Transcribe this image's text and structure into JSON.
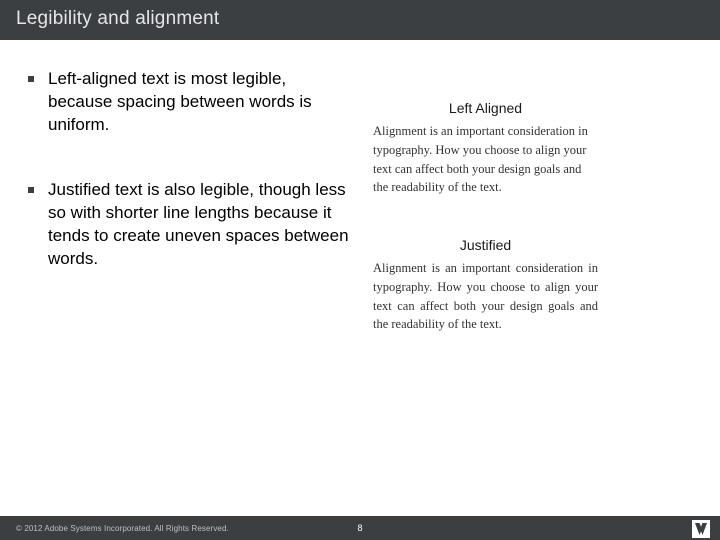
{
  "slide": {
    "title": "Legibility and alignment",
    "bullets": [
      "Left-aligned text is most legible, because spacing between words is uniform.",
      "Justified text is also legible, though less so with shorter line lengths because it tends to create uneven spaces between words."
    ],
    "examples": {
      "left": {
        "heading": "Left Aligned",
        "body": "Alignment is an important consideration in typography. How you choose to align your text can affect both your design goals and the readability of the text."
      },
      "justified": {
        "heading": "Justified",
        "body": "Alignment is an important consideration in typography. How you choose to align your text can affect both your design goals and the readability of the text."
      }
    }
  },
  "footer": {
    "copyright": "© 2012 Adobe Systems Incorporated. All Rights Reserved.",
    "page_number": "8",
    "logo_name": "adobe-logo"
  }
}
